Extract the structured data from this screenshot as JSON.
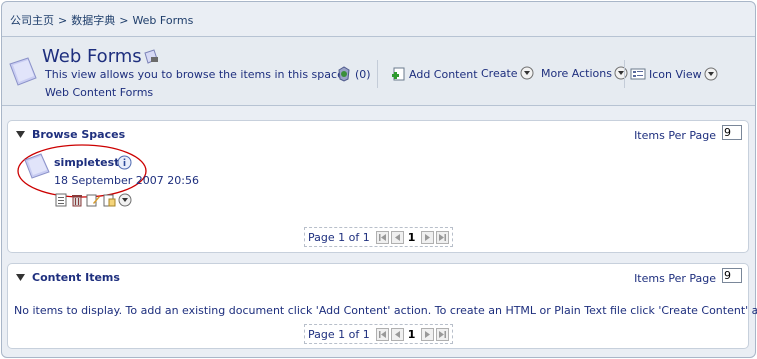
{
  "breadcrumb": {
    "items": [
      "公司主页",
      "数据字典",
      "Web Forms"
    ],
    "separator": ">"
  },
  "header": {
    "title": "Web Forms",
    "description": "This view allows you to browse the items in this space.",
    "subtitle": "Web Content Forms"
  },
  "toolbar": {
    "discussion_count": "(0)",
    "add_content": "Add Content",
    "create": "Create",
    "more_actions": "More Actions",
    "icon_view": "Icon View"
  },
  "browse_spaces": {
    "title": "Browse Spaces",
    "items_per_page_label": "Items Per Page",
    "items_per_page_value": "9",
    "items": [
      {
        "name": "simpletest",
        "date": "18 September 2007 20:56"
      }
    ],
    "pager": {
      "label": "Page 1 of 1",
      "current": "1"
    }
  },
  "content_items": {
    "title": "Content Items",
    "items_per_page_label": "Items Per Page",
    "items_per_page_value": "9",
    "empty_message": "No items to display. To add an existing document click 'Add Content' action. To create an HTML or Plain Text file click 'Create Content' action.",
    "pager": {
      "label": "Page 1 of 1",
      "current": "1"
    }
  },
  "colors": {
    "link": "#1e2f7e",
    "band": "#e6ebf1",
    "highlight": "#cc0000"
  }
}
